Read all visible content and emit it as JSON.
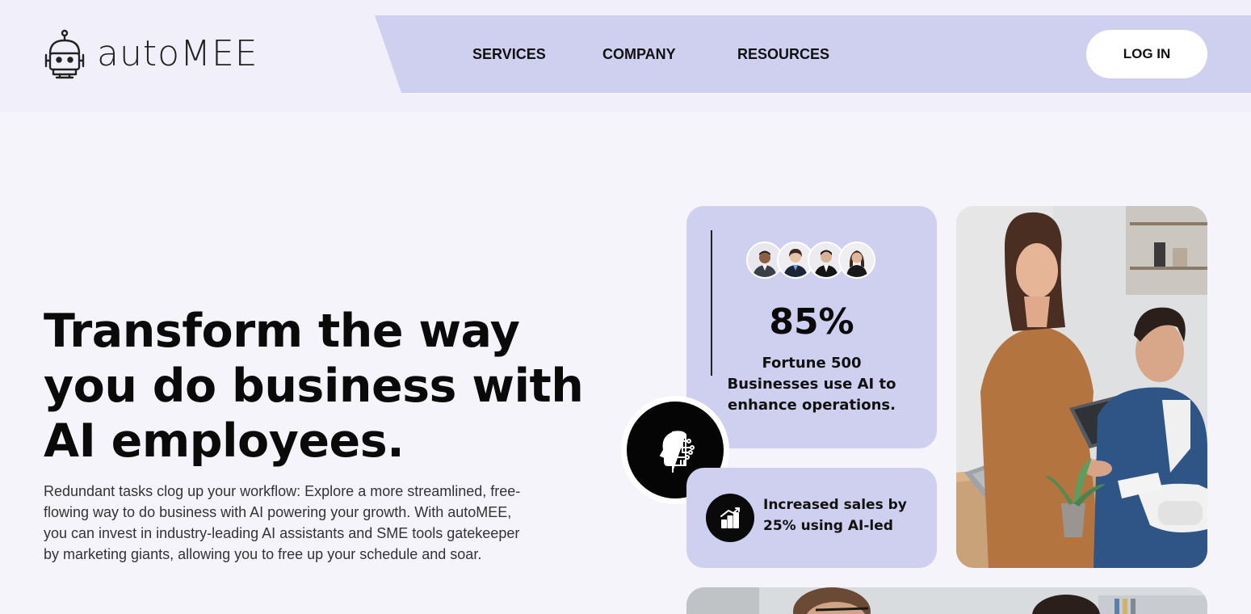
{
  "header": {
    "logo_text": "autoMEE",
    "nav": [
      {
        "label": "SERVICES"
      },
      {
        "label": "COMPANY"
      },
      {
        "label": "RESOURCES"
      }
    ],
    "login_label": "LOG IN"
  },
  "hero": {
    "title": "Transform the way you do business with AI employees.",
    "description": "Redundant tasks clog up your workflow: Explore a more streamlined, free-flowing way to do business with AI powering your growth. With autoMEE, you can invest in industry-leading AI assistants and SME tools gatekeeper by marketing giants, allowing you to free up your schedule and soar."
  },
  "stats": {
    "value": "85%",
    "label": "Fortune 500 Businesses use AI to enhance operations."
  },
  "sales": {
    "text": "Increased sales by 25% using AI-led"
  },
  "colors": {
    "accent": "#cfcfef",
    "background": "#f5f4fb",
    "header_background": "#f1f0fa"
  },
  "icons": {
    "logo": "robot-icon",
    "badge": "ai-brain-icon",
    "sales": "bar-chart-icon"
  }
}
